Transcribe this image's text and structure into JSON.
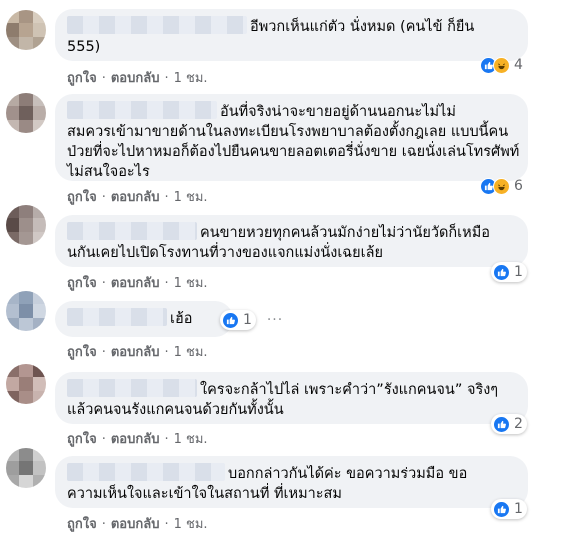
{
  "reaction_count_color": "#65676b",
  "like_color": "#1877f2",
  "haha_color": "#f7b125",
  "bubble_color": "#f0f2f5",
  "comments": [
    {
      "text_first": "อีพวกเห็นแก่ตัว นั่งหมด (คนไข้ ก็ยืน",
      "text_rest": "555)",
      "reactions": [
        "like-icon",
        "haha-icon"
      ],
      "count": "4",
      "action_like": "ถูกใจ",
      "action_reply": "ตอบกลับ",
      "time": "1 ชม."
    },
    {
      "text_first": "อันที่จริงน่าจะขายอยู่ด้านนอกนะไม่ไม่",
      "text_rest": "สมควรเข้ามาขายด้านในลงทะเบียนโรงพยาบาลต้องตั้งกฎเลย แบบนี้คนป่วยที่จะไปหาหมอก็ต้องไปยืนคนขายลอตเตอรี่นั่งขาย เฉยนั่งเล่นโทรศัพท์ไม่สนใจอะไร",
      "reactions": [
        "like-icon",
        "haha-icon"
      ],
      "count": "6",
      "action_like": "ถูกใจ",
      "action_reply": "ตอบกลับ",
      "time": "1 ชม."
    },
    {
      "text_first": "คนขายหวยทุกคนล้วนมักง่ายไม่ว่านัยวัดก็เหมือ",
      "text_rest": "นกันเคยไปเปิดโรงทานที่วางของแจกแม่งนั่งเฉยเล้ย",
      "reactions": [
        "like-icon"
      ],
      "count": "1",
      "action_like": "ถูกใจ",
      "action_reply": "ตอบกลับ",
      "time": "1 ชม."
    },
    {
      "text_first": "เฮ้อ",
      "text_rest": "",
      "reactions": [
        "like-icon"
      ],
      "count": "1",
      "action_like": "ถูกใจ",
      "action_reply": "ตอบกลับ",
      "time": "1 ชม."
    },
    {
      "text_first": "ใครจะกล้าไปไล่ เพราะคำว่า”รังแกคนจน” จริงๆ",
      "text_rest": "แล้วคนจนรังแกคนจนด้วยกันทั้งนั้น",
      "reactions": [
        "like-icon"
      ],
      "count": "2",
      "action_like": "ถูกใจ",
      "action_reply": "ตอบกลับ",
      "time": "1 ชม."
    },
    {
      "text_first": "บอกกล่าวกันได้ค่ะ ขอความร่วมมือ ขอ",
      "text_rest": "ความเห็นใจและเข้าใจในสถานที่ ที่เหมาะสม",
      "reactions": [
        "like-icon"
      ],
      "count": "1",
      "action_like": "ถูกใจ",
      "action_reply": "ตอบกลับ",
      "time": "1 ชม."
    }
  ]
}
